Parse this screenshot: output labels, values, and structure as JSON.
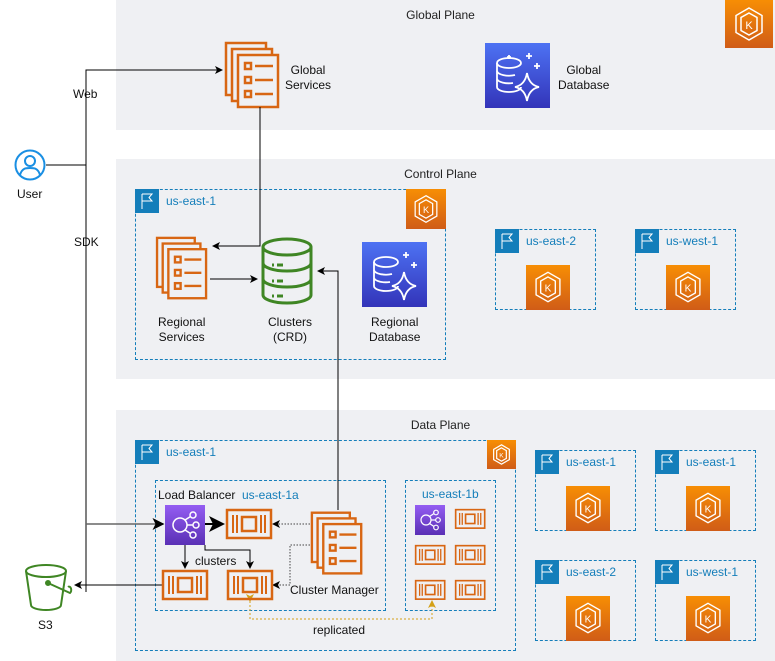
{
  "planes": {
    "global": {
      "title": "Global Plane"
    },
    "control": {
      "title": "Control Plane"
    },
    "data": {
      "title": "Data Plane"
    }
  },
  "global_plane": {
    "global_services_label_line1": "Global",
    "global_services_label_line2": "Services",
    "global_database_label_line1": "Global",
    "global_database_label_line2": "Database"
  },
  "control_plane": {
    "primary_region": "us-east-1",
    "regional_services_line1": "Regional",
    "regional_services_line2": "Services",
    "clusters_line1": "Clusters",
    "clusters_line2": "(CRD)",
    "regional_database_line1": "Regional",
    "regional_database_line2": "Database",
    "other_regions": [
      "us-east-2",
      "us-west-1"
    ]
  },
  "data_plane": {
    "primary_region": "us-east-1",
    "az_a": "us-east-1a",
    "az_b": "us-east-1b",
    "load_balancer_label": "Load Balancer",
    "clusters_label": "clusters",
    "cluster_manager_label": "Cluster Manager",
    "replicated_label": "replicated",
    "other_regions": [
      "us-east-1",
      "us-east-1",
      "us-east-2",
      "us-west-1"
    ]
  },
  "external": {
    "user_label": "User",
    "web_label": "Web",
    "sdk_label": "SDK",
    "s3_label": "S3"
  },
  "colors": {
    "aws_orange": "#d86613",
    "region_blue": "#147eba",
    "s3_green": "#3f8624",
    "replicated_line": "#d4a017",
    "plane_bg": "#eff0f3"
  }
}
